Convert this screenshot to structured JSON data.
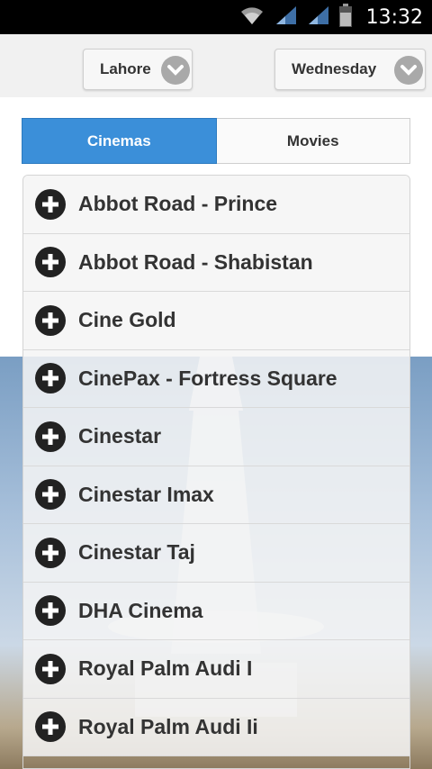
{
  "status_bar": {
    "time": "13:32",
    "icons": [
      "wifi-icon",
      "signal-icon",
      "signal-icon",
      "battery-icon"
    ]
  },
  "filters": {
    "city": "Lahore",
    "day": "Wednesday"
  },
  "tabs": [
    {
      "label": "Cinemas",
      "active": true
    },
    {
      "label": "Movies",
      "active": false
    }
  ],
  "cinemas": [
    "Abbot Road - Prince",
    "Abbot Road - Shabistan",
    "Cine Gold",
    "CinePax - Fortress Square",
    "Cinestar",
    "Cinestar Imax",
    "Cinestar Taj",
    "DHA Cinema",
    "Royal Palm Audi I",
    "Royal Palm Audi Ii"
  ],
  "colors": {
    "accent": "#3b8fd9",
    "status_bar": "#000000"
  }
}
